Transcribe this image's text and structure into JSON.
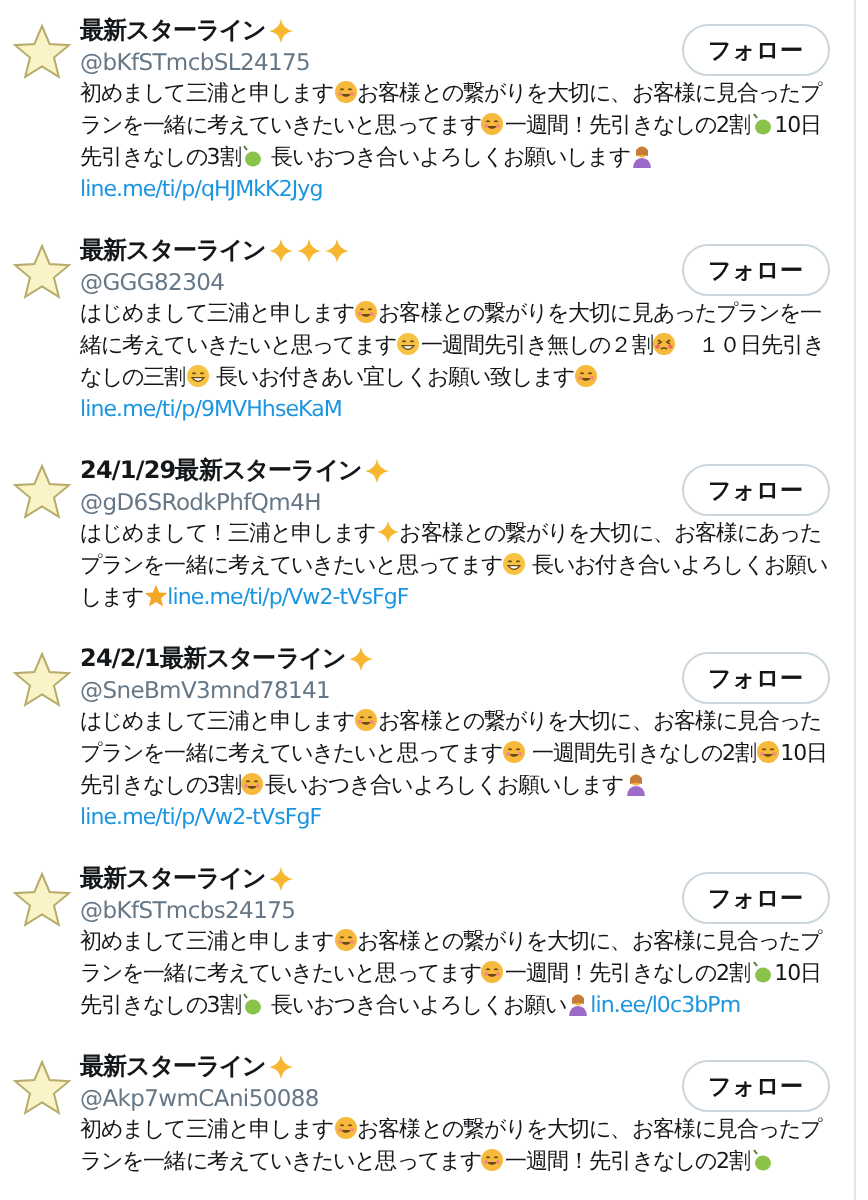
{
  "accounts": [
    {
      "name": "最新スターライン",
      "name_icons": [
        {
          "kind": "sparkle"
        }
      ],
      "handle": "@bKfSTmcbSL24175",
      "follow_label": "フォロー",
      "bio": [
        {
          "kind": "text",
          "text": "初めまして三浦と申します"
        },
        {
          "kind": "face"
        },
        {
          "kind": "text",
          "text": "お客様との繋がりを大切に、お客様に見合ったプランを一緒に考えていきたいと思ってます"
        },
        {
          "kind": "face"
        },
        {
          "kind": "text",
          "text": "一週間！先引きなしの2割"
        },
        {
          "kind": "leaf"
        },
        {
          "kind": "text",
          "text": "10日先引きなしの3割"
        },
        {
          "kind": "leaf"
        },
        {
          "kind": "text",
          "text": " 長いおつき合いよろしくお願いします"
        },
        {
          "kind": "person"
        },
        {
          "kind": "link",
          "text": "line.me/ti/p/qHJMkK2Jyg"
        }
      ]
    },
    {
      "name": "最新スターライン",
      "name_icons": [
        {
          "kind": "sparkle"
        },
        {
          "kind": "sparkle"
        },
        {
          "kind": "sparkle"
        }
      ],
      "handle": "@GGG82304",
      "follow_label": "フォロー",
      "bio": [
        {
          "kind": "text",
          "text": "はじめまして三浦と申します"
        },
        {
          "kind": "face"
        },
        {
          "kind": "text",
          "text": "お客様との繋がりを大切に見あったプランを一緒に考えていきたいと思ってます"
        },
        {
          "kind": "grin"
        },
        {
          "kind": "text",
          "text": "一週間先引き無しの２割"
        },
        {
          "kind": "blush"
        },
        {
          "kind": "text",
          "text": "　１０日先引きなしの三割"
        },
        {
          "kind": "grin"
        },
        {
          "kind": "text",
          "text": " 長いお付きあい宜しくお願い致します"
        },
        {
          "kind": "face"
        },
        {
          "kind": "link",
          "text": "line.me/ti/p/9MVHhseKaM"
        }
      ]
    },
    {
      "name": "24/1/29最新スターライン",
      "name_icons": [
        {
          "kind": "sparkle"
        }
      ],
      "handle": "@gD6SRodkPhfQm4H",
      "follow_label": "フォロー",
      "bio": [
        {
          "kind": "text",
          "text": "はじめまして！三浦と申します"
        },
        {
          "kind": "sparkle"
        },
        {
          "kind": "text",
          "text": "お客様との繋がりを大切に、お客様にあったプランを一緒に考えていきたいと思ってます"
        },
        {
          "kind": "grin"
        },
        {
          "kind": "text",
          "text": " 長いお付き合いよろしくお願いします"
        },
        {
          "kind": "star"
        },
        {
          "kind": "link",
          "text": "line.me/ti/p/Vw2-tVsFgF"
        }
      ]
    },
    {
      "name": "24/2/1最新スターライン",
      "name_icons": [
        {
          "kind": "sparkle"
        }
      ],
      "handle": "@SneBmV3mnd78141",
      "follow_label": "フォロー",
      "bio": [
        {
          "kind": "text",
          "text": "はじめまして三浦と申します"
        },
        {
          "kind": "face"
        },
        {
          "kind": "text",
          "text": "お客様との繋がりを大切に、お客様に見合ったプランを一緒に考えていきたいと思ってます"
        },
        {
          "kind": "face"
        },
        {
          "kind": "text",
          "text": " 一週間先引きなしの2割"
        },
        {
          "kind": "face"
        },
        {
          "kind": "text",
          "text": "10日先引きなしの3割"
        },
        {
          "kind": "face"
        },
        {
          "kind": "text",
          "text": "長いおつき合いよろしくお願いします"
        },
        {
          "kind": "person"
        },
        {
          "kind": "link",
          "text": "line.me/ti/p/Vw2-tVsFgF"
        }
      ]
    },
    {
      "name": "最新スターライン",
      "name_icons": [
        {
          "kind": "sparkle"
        }
      ],
      "handle": "@bKfSTmcbs24175",
      "follow_label": "フォロー",
      "bio": [
        {
          "kind": "text",
          "text": "初めまして三浦と申します"
        },
        {
          "kind": "face"
        },
        {
          "kind": "text",
          "text": "お客様との繋がりを大切に、お客様に見合ったプランを一緒に考えていきたいと思ってます"
        },
        {
          "kind": "face"
        },
        {
          "kind": "text",
          "text": "一週間！先引きなしの2割"
        },
        {
          "kind": "leaf"
        },
        {
          "kind": "text",
          "text": "10日先引きなしの3割"
        },
        {
          "kind": "leaf"
        },
        {
          "kind": "text",
          "text": " 長いおつき合いよろしくお願い"
        },
        {
          "kind": "person"
        },
        {
          "kind": "link",
          "text": "lin.ee/l0c3bPm"
        }
      ]
    },
    {
      "name": "最新スターライン",
      "name_icons": [
        {
          "kind": "sparkle"
        }
      ],
      "handle": "@Akp7wmCAni50088",
      "follow_label": "フォロー",
      "bio": [
        {
          "kind": "text",
          "text": "初めまして三浦と申します"
        },
        {
          "kind": "face"
        },
        {
          "kind": "text",
          "text": "お客様との繋がりを大切に、お客様に見合ったプランを一緒に考えていきたいと思ってます"
        },
        {
          "kind": "face"
        },
        {
          "kind": "text",
          "text": "一週間！先引きなしの2割"
        },
        {
          "kind": "leaf"
        }
      ]
    }
  ]
}
